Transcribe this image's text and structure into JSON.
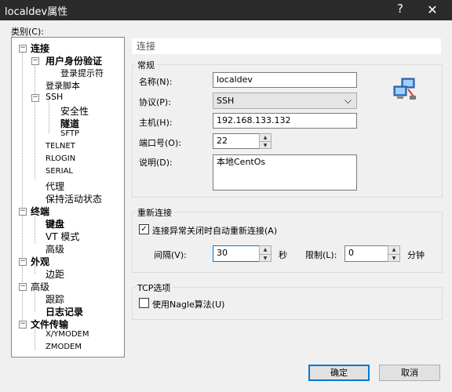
{
  "window": {
    "title": "localdev属性",
    "help": "?",
    "close": "✕"
  },
  "category_label": "类别(C):",
  "tree": {
    "connection": "连接",
    "user_auth": "用户身份验证",
    "login_prompt": "登录提示符",
    "login_script": "登录脚本",
    "ssh": "SSH",
    "security": "安全性",
    "tunnel": "隧道",
    "sftp": "SFTP",
    "telnet": "TELNET",
    "rlogin": "RLOGIN",
    "serial": "SERIAL",
    "proxy": "代理",
    "keepalive": "保持活动状态",
    "terminal": "终端",
    "keyboard": "键盘",
    "vt_mode": "VT 模式",
    "advanced_t": "高级",
    "appearance": "外观",
    "margin": "边距",
    "advanced": "高级",
    "trace": "跟踪",
    "log": "日志记录",
    "file_transfer": "文件传输",
    "xymodem": "X/YMODEM",
    "zmodem": "ZMODEM"
  },
  "panel": {
    "header": "连接",
    "general_group": "常规",
    "name_label": "名称(N):",
    "name_value": "localdev",
    "protocol_label": "协议(P):",
    "protocol_value": "SSH",
    "host_label": "主机(H):",
    "host_value": "192.168.133.132",
    "port_label": "端口号(O):",
    "port_value": "22",
    "desc_label": "说明(D):",
    "desc_value": "本地CentOs",
    "reconnect_group": "重新连接",
    "reconnect_check": "连接异常关闭时自动重新连接(A)",
    "interval_label": "间隔(V):",
    "interval_value": "30",
    "seconds": "秒",
    "limit_label": "限制(L):",
    "limit_value": "0",
    "minutes": "分钟",
    "tcp_group": "TCP选项",
    "nagle_check": "使用Nagle算法(U)"
  },
  "buttons": {
    "ok": "确定",
    "cancel": "取消"
  },
  "icons": {
    "chevron": "⌵",
    "up": "▲",
    "down": "▼",
    "check": "✓",
    "minus": "−"
  },
  "colors": {
    "accent": "#0078d7",
    "titlebar": "#2b2b2b"
  }
}
